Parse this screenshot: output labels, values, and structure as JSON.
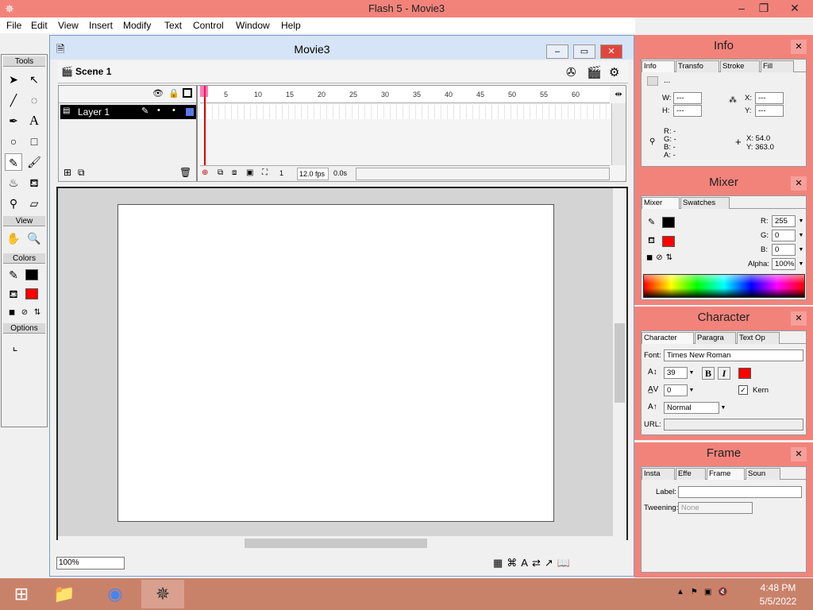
{
  "app": {
    "title": "Flash 5 - Movie3",
    "icon": "flash-logo-icon"
  },
  "window_controls": {
    "minimize": "–",
    "restore": "❐",
    "close": "✕"
  },
  "menu": [
    "File",
    "Edit",
    "View",
    "Insert",
    "Modify",
    "Text",
    "Control",
    "Window",
    "Help"
  ],
  "tools_panel": {
    "sections": {
      "tools": "Tools",
      "view": "View",
      "colors": "Colors",
      "options": "Options"
    },
    "stroke_color": "#000000",
    "fill_color": "#ff0000"
  },
  "movie": {
    "title": "Movie3",
    "scene": "Scene 1",
    "ruler": [
      "5",
      "10",
      "15",
      "20",
      "25",
      "30",
      "35",
      "40",
      "45",
      "50",
      "55",
      "60"
    ],
    "layer": "Layer 1",
    "current_frame": "1",
    "frame_rate": "12.0 fps",
    "elapsed": "0.0s",
    "zoom": "100%"
  },
  "info_panel": {
    "title": "Info",
    "tabs": [
      "Info",
      "Transfo",
      "Stroke",
      "Fill"
    ],
    "w_label": "W:",
    "w_value": "---",
    "h_label": "H:",
    "h_value": "---",
    "x_label": "X:",
    "x_value": "---",
    "y_label": "Y:",
    "y_value": "---",
    "r": "R: -",
    "g": "G: -",
    "b": "B: -",
    "a": "A: -",
    "cursor_x": "X:  54.0",
    "cursor_y": "Y:  363.0"
  },
  "mixer_panel": {
    "title": "Mixer",
    "tabs": [
      "Mixer",
      "Swatches"
    ],
    "r_label": "R:",
    "r_value": "255",
    "g_label": "G:",
    "g_value": "0",
    "b_label": "B:",
    "b_value": "0",
    "alpha_label": "Alpha:",
    "alpha_value": "100%"
  },
  "character_panel": {
    "title": "Character",
    "tabs": [
      "Character",
      "Paragra",
      "Text Op"
    ],
    "font_label": "Font:",
    "font_value": "Times New Roman",
    "size_value": "39",
    "bold": "B",
    "italic": "I",
    "tracking_value": "0",
    "kern_label": "Kern",
    "baseline_value": "Normal",
    "url_label": "URL:",
    "text_color": "#ff0000"
  },
  "frame_panel": {
    "title": "Frame",
    "tabs": [
      "Insta",
      "Effe",
      "Frame",
      "Soun"
    ],
    "label_label": "Label:",
    "tweening_label": "Tweening:",
    "tweening_value": "None"
  },
  "taskbar": {
    "time": "4:48 PM",
    "date": "5/5/2022"
  }
}
